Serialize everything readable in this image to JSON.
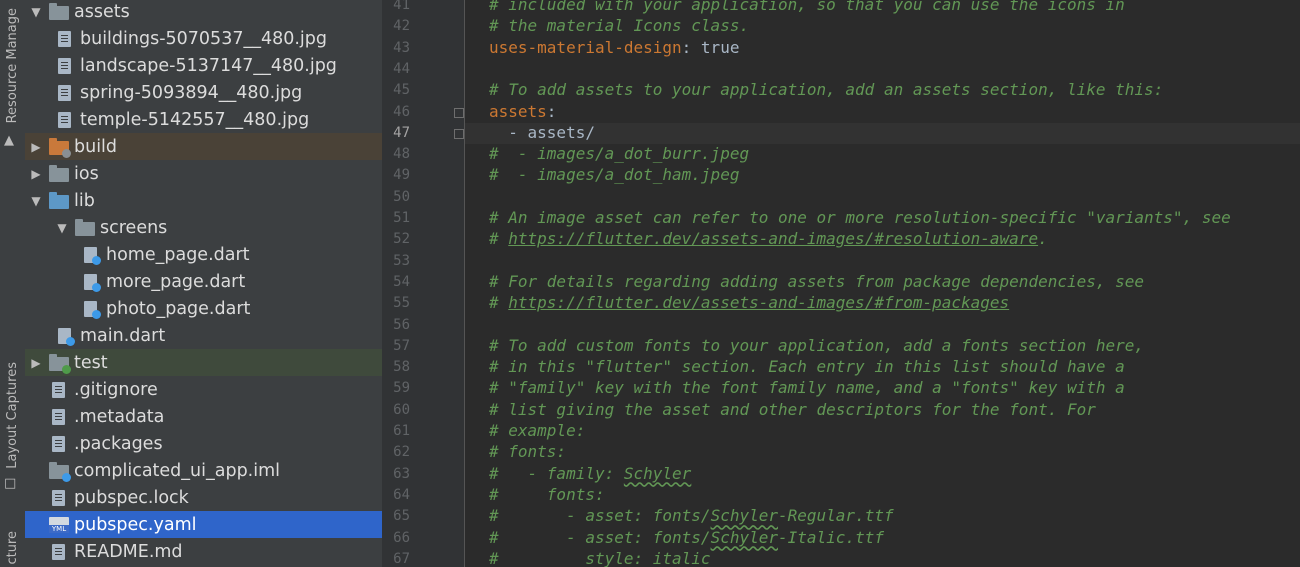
{
  "tool_strip": {
    "resource_manager": "Resource Manage",
    "layout_captures": "Layout Captures",
    "structure": "cture"
  },
  "tree": [
    {
      "label": "assets",
      "type": "folder",
      "expanded": true,
      "depth": 0
    },
    {
      "label": "buildings-5070537__480.jpg",
      "type": "image",
      "depth": 1
    },
    {
      "label": "landscape-5137147__480.jpg",
      "type": "image",
      "depth": 1
    },
    {
      "label": "spring-5093894__480.jpg",
      "type": "image",
      "depth": 1
    },
    {
      "label": "temple-5142557__480.jpg",
      "type": "image",
      "depth": 1
    },
    {
      "label": "build",
      "type": "folder-orange",
      "expanded": false,
      "depth": 0
    },
    {
      "label": "ios",
      "type": "folder",
      "expanded": false,
      "depth": 0
    },
    {
      "label": "lib",
      "type": "folder-blue",
      "expanded": true,
      "depth": 0
    },
    {
      "label": "screens",
      "type": "folder",
      "expanded": true,
      "depth": 1
    },
    {
      "label": "home_page.dart",
      "type": "dart",
      "depth": 2
    },
    {
      "label": "more_page.dart",
      "type": "dart",
      "depth": 2
    },
    {
      "label": "photo_page.dart",
      "type": "dart",
      "depth": 2
    },
    {
      "label": "main.dart",
      "type": "dart",
      "depth": 1
    },
    {
      "label": "test",
      "type": "folder-test",
      "expanded": false,
      "depth": 0
    },
    {
      "label": ".gitignore",
      "type": "text",
      "depth": 0
    },
    {
      "label": ".metadata",
      "type": "text",
      "depth": 0
    },
    {
      "label": ".packages",
      "type": "text",
      "depth": 0
    },
    {
      "label": "complicated_ui_app.iml",
      "type": "iml",
      "depth": 0
    },
    {
      "label": "pubspec.lock",
      "type": "text",
      "depth": 0
    },
    {
      "label": "pubspec.yaml",
      "type": "yml",
      "depth": 0,
      "selected": true
    },
    {
      "label": "README.md",
      "type": "text",
      "depth": 0
    }
  ],
  "editor": {
    "current_line": "47",
    "lines": [
      {
        "n": "41",
        "parts": [
          {
            "t": "# included with your application, so that you can use the icons in",
            "c": "cm"
          }
        ]
      },
      {
        "n": "42",
        "parts": [
          {
            "t": "# the material Icons class.",
            "c": "cm"
          }
        ]
      },
      {
        "n": "43",
        "parts": [
          {
            "t": "uses-material-design",
            "c": "key"
          },
          {
            "t": ": true",
            "c": "val"
          }
        ]
      },
      {
        "n": "44",
        "parts": []
      },
      {
        "n": "45",
        "parts": [
          {
            "t": "# To add assets to your application, add an assets section, like this:",
            "c": "cm"
          }
        ]
      },
      {
        "n": "46",
        "parts": [
          {
            "t": "assets",
            "c": "key"
          },
          {
            "t": ":",
            "c": "val"
          }
        ]
      },
      {
        "n": "47",
        "parts": [
          {
            "t": "  - assets/",
            "c": "val"
          }
        ]
      },
      {
        "n": "48",
        "parts": [
          {
            "t": "#  - images/a_dot_burr.jpeg",
            "c": "cm"
          }
        ]
      },
      {
        "n": "49",
        "parts": [
          {
            "t": "#  - images/a_dot_ham.jpeg",
            "c": "cm"
          }
        ]
      },
      {
        "n": "50",
        "parts": []
      },
      {
        "n": "51",
        "parts": [
          {
            "t": "# An image asset can refer to one or more resolution-specific \"variants\", see",
            "c": "cm"
          }
        ]
      },
      {
        "n": "52",
        "parts": [
          {
            "t": "# ",
            "c": "cm"
          },
          {
            "t": "https://flutter.dev/assets-and-images/#resolution-aware",
            "c": "link"
          },
          {
            "t": ".",
            "c": "cm"
          }
        ]
      },
      {
        "n": "53",
        "parts": []
      },
      {
        "n": "54",
        "parts": [
          {
            "t": "# For details regarding adding assets from package dependencies, see",
            "c": "cm"
          }
        ]
      },
      {
        "n": "55",
        "parts": [
          {
            "t": "# ",
            "c": "cm"
          },
          {
            "t": "https://flutter.dev/assets-and-images/#from-packages",
            "c": "link"
          }
        ]
      },
      {
        "n": "56",
        "parts": []
      },
      {
        "n": "57",
        "parts": [
          {
            "t": "# To add custom fonts to your application, add a fonts section here,",
            "c": "cm"
          }
        ]
      },
      {
        "n": "58",
        "parts": [
          {
            "t": "# in this \"flutter\" section. Each entry in this list should have a",
            "c": "cm"
          }
        ]
      },
      {
        "n": "59",
        "parts": [
          {
            "t": "# \"family\" key with the font family name, and a \"fonts\" key with a",
            "c": "cm"
          }
        ]
      },
      {
        "n": "60",
        "parts": [
          {
            "t": "# list giving the asset and other descriptors for the font. For",
            "c": "cm"
          }
        ]
      },
      {
        "n": "61",
        "parts": [
          {
            "t": "# example:",
            "c": "cm"
          }
        ]
      },
      {
        "n": "62",
        "parts": [
          {
            "t": "# fonts:",
            "c": "cm"
          }
        ]
      },
      {
        "n": "63",
        "parts": [
          {
            "t": "#   - family: ",
            "c": "cm"
          },
          {
            "t": "Schyler",
            "c": "cm sq"
          }
        ]
      },
      {
        "n": "64",
        "parts": [
          {
            "t": "#     fonts:",
            "c": "cm"
          }
        ]
      },
      {
        "n": "65",
        "parts": [
          {
            "t": "#       - asset: fonts/",
            "c": "cm"
          },
          {
            "t": "Schyler",
            "c": "cm sq"
          },
          {
            "t": "-Regular.ttf",
            "c": "cm"
          }
        ]
      },
      {
        "n": "66",
        "parts": [
          {
            "t": "#       - asset: fonts/",
            "c": "cm"
          },
          {
            "t": "Schyler",
            "c": "cm sq"
          },
          {
            "t": "-Italic.ttf",
            "c": "cm"
          }
        ]
      },
      {
        "n": "67",
        "parts": [
          {
            "t": "#         style: italic",
            "c": "cm"
          }
        ]
      }
    ]
  },
  "colors": {
    "selection": "#2f65ca",
    "comment": "#629755",
    "key": "#cc7832"
  }
}
